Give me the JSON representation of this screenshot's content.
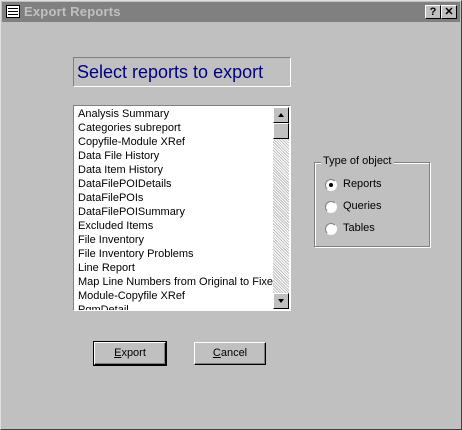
{
  "window": {
    "title": "Export Reports",
    "help_button": "?",
    "close_button": "✕"
  },
  "heading": "Select reports to export",
  "reports_list": [
    "Analysis Summary",
    "Categories subreport",
    "Copyfile-Module XRef",
    "Data File History",
    "Data Item History",
    "DataFilePOIDetails",
    "DataFilePOIs",
    "DataFilePOISummary",
    "Excluded Items",
    "File Inventory",
    "File Inventory Problems",
    "Line Report",
    "Map Line Numbers from Original to Fixed Source",
    "Module-Copyfile XRef",
    "PgmDetail"
  ],
  "object_type": {
    "label": "Type of object",
    "options": [
      {
        "label": "Reports",
        "selected": true
      },
      {
        "label": "Queries",
        "selected": false
      },
      {
        "label": "Tables",
        "selected": false
      }
    ]
  },
  "buttons": {
    "export": {
      "accel": "E",
      "rest": "xport"
    },
    "cancel": {
      "accel": "C",
      "rest": "ancel"
    }
  },
  "icons": {
    "window": "form-icon",
    "scroll_up": "arrow-up-icon",
    "scroll_down": "arrow-down-icon"
  }
}
